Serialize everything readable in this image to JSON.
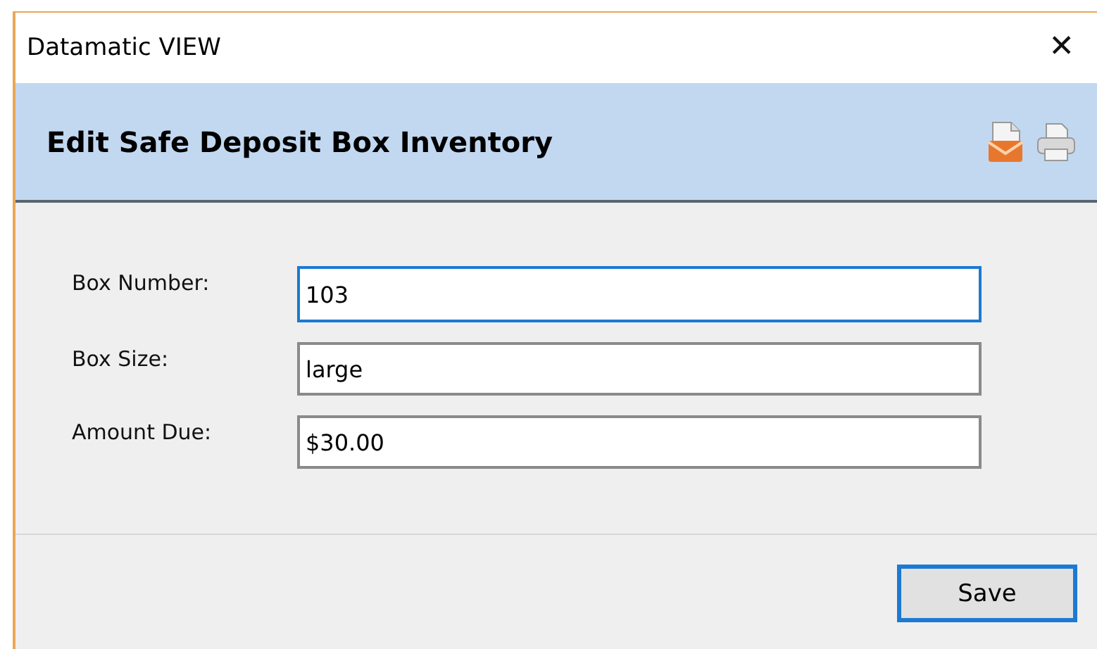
{
  "window": {
    "title": "Datamatic VIEW",
    "close": "✕"
  },
  "header": {
    "title": "Edit Safe Deposit Box Inventory"
  },
  "fields": [
    {
      "label": "Box Number:",
      "value": "103",
      "focused": true
    },
    {
      "label": "Box Size:",
      "value": "large",
      "focused": false
    },
    {
      "label": "Amount Due:",
      "value": "$30.00",
      "focused": false
    }
  ],
  "buttons": [
    {
      "label": "Save",
      "default": true
    }
  ]
}
